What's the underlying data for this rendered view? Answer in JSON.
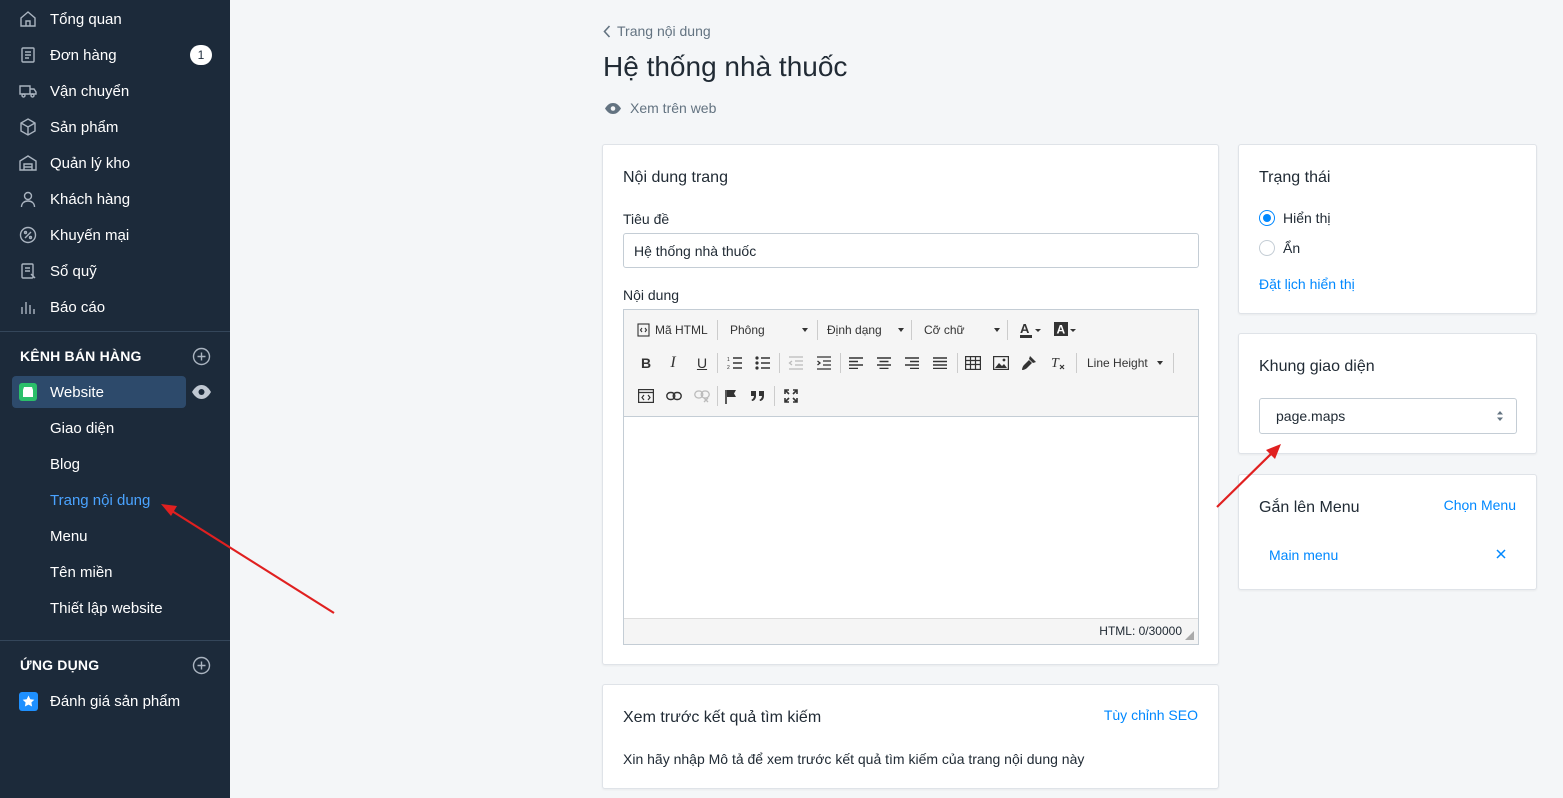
{
  "sidebar": {
    "nav": [
      {
        "label": "Tổng quan",
        "icon": "home-icon"
      },
      {
        "label": "Đơn hàng",
        "icon": "order-icon",
        "badge": "1"
      },
      {
        "label": "Vận chuyển",
        "icon": "truck-icon"
      },
      {
        "label": "Sản phẩm",
        "icon": "box-icon"
      },
      {
        "label": "Quản lý kho",
        "icon": "warehouse-icon"
      },
      {
        "label": "Khách hàng",
        "icon": "user-icon"
      },
      {
        "label": "Khuyến mại",
        "icon": "percent-icon"
      },
      {
        "label": "Sổ quỹ",
        "icon": "ledger-icon"
      },
      {
        "label": "Báo cáo",
        "icon": "chart-icon"
      }
    ],
    "channels_heading": "KÊNH BÁN HÀNG",
    "website_label": "Website",
    "website_sub": [
      "Giao diện",
      "Blog",
      "Trang nội dung",
      "Menu",
      "Tên miền",
      "Thiết lập website"
    ],
    "apps_heading": "ỨNG DỤNG",
    "app_item": "Đánh giá sản phẩm"
  },
  "header": {
    "breadcrumb": "Trang nội dung",
    "title": "Hệ thống nhà thuốc",
    "view_web": "Xem trên web"
  },
  "content_card": {
    "heading": "Nội dung trang",
    "title_label": "Tiêu đề",
    "title_value": "Hệ thống nhà thuốc",
    "content_label": "Nội dung",
    "toolbar": {
      "html_button": "Mã HTML",
      "font": "Phông",
      "format": "Định dạng",
      "size": "Cỡ chữ",
      "line_height": "Line Height"
    },
    "status": "HTML: 0/30000"
  },
  "seo_card": {
    "heading": "Xem trước kết quả tìm kiếm",
    "link": "Tùy chỉnh SEO",
    "hint": "Xin hãy nhập Mô tả để xem trước kết quả tìm kiếm của trang nội dung này"
  },
  "status_card": {
    "heading": "Trạng thái",
    "option_show": "Hiển thị",
    "option_hide": "Ẩn",
    "schedule_link": "Đặt lịch hiển thị",
    "selected": "Hiển thị"
  },
  "template_card": {
    "heading": "Khung giao diện",
    "selected": "page.maps"
  },
  "menu_card": {
    "heading": "Gắn lên Menu",
    "link": "Chọn Menu",
    "item": "Main menu"
  },
  "colors": {
    "sidebar": "#1c2a3a",
    "accent": "#0088ff",
    "arrow": "#e02020"
  }
}
